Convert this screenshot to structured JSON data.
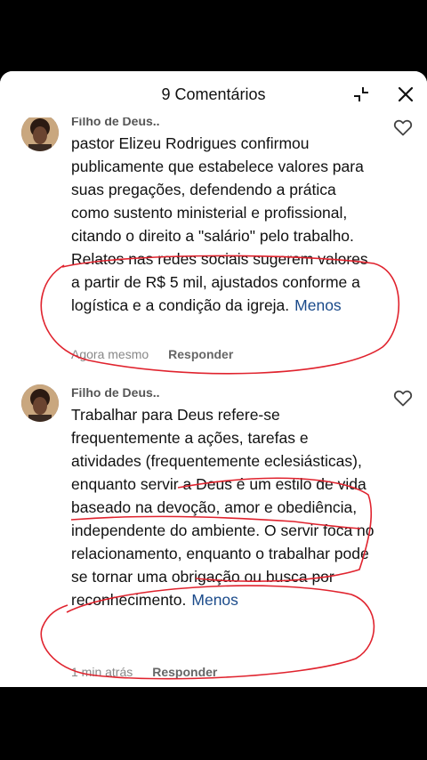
{
  "header": {
    "title": "9 Comentários",
    "collapse_icon": "collapse-icon",
    "close_icon": "close-icon"
  },
  "comments": [
    {
      "author": "Filho de Deus..",
      "text": "pastor Elizeu Rodrigues confirmou publicamente que estabelece valores para suas pregações, defendendo a prática como sustento ministerial e profissional, citando o direito a \"salário\" pelo trabalho. Relatos nas redes sociais sugerem valores a partir de R$ 5 mil, ajustados conforme a logística e a condição da igreja.",
      "more_label": "Menos",
      "time": "Agora mesmo",
      "reply_label": "Responder",
      "like_icon": "heart-outline-icon"
    },
    {
      "author": "Filho de Deus..",
      "text": "Trabalhar para Deus refere-se frequentemente a ações, tarefas e atividades (frequentemente eclesiásticas), enquanto servir a Deus é um estilo de vida baseado na devoção, amor e obediência, independente do ambiente. O servir foca no relacionamento, enquanto o trabalhar pode se tornar uma obrigação ou busca por reconhecimento.",
      "more_label": "Menos",
      "time": "1 min atrás",
      "reply_label": "Responder",
      "like_icon": "heart-outline-icon"
    }
  ],
  "colors": {
    "annotation_red": "#e0232e",
    "link_blue": "#1a4a8a"
  }
}
